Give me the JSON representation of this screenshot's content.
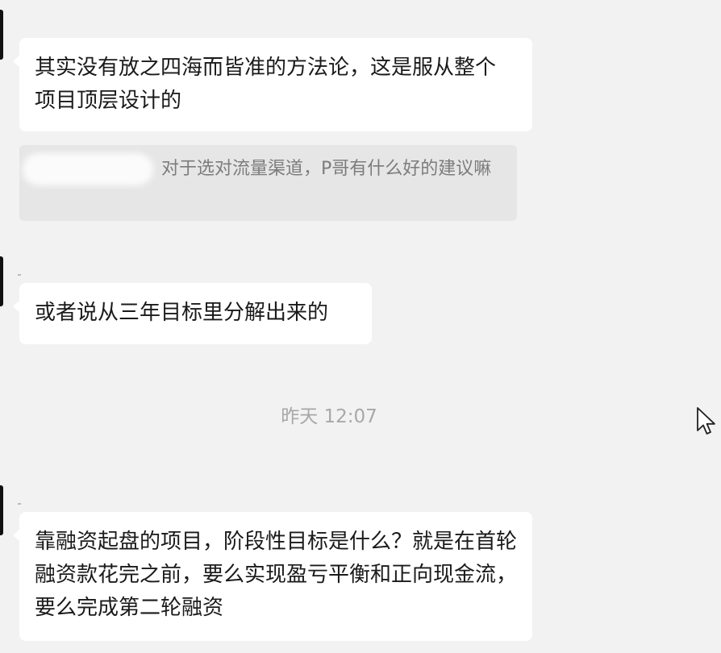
{
  "messages": [
    {
      "text": "其实没有放之四海而皆准的方法论，这是服从整个项目顶层设计的"
    },
    {
      "quote": "P哥有什么好的建议嘛",
      "quote_full": "对于选对流量渠道，P哥有什么好的建议嘛"
    },
    {
      "text": "或者说从三年目标里分解出来的"
    },
    {
      "text": "靠融资起盘的项目，阶段性目标是什么？就是在首轮融资款花完之前，要么实现盈亏平衡和正向现金流，要么完成第二轮融资"
    }
  ],
  "timestamp": "昨天 12:07",
  "icons": {
    "cursor": "mouse-pointer-icon"
  },
  "colors": {
    "background": "#f2f2f2",
    "bubble": "#ffffff",
    "quote_bg": "#e6e6e6",
    "timestamp": "#a8a8a8"
  }
}
